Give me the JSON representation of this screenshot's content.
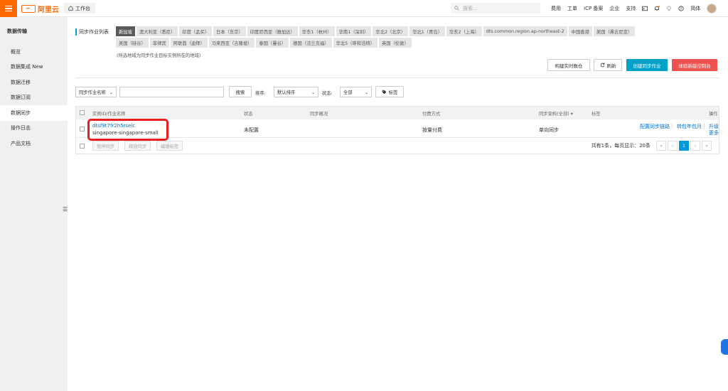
{
  "topbar": {
    "logo_text": "阿里云",
    "workbench_label": "工作台",
    "search_placeholder": "搜索...",
    "nav": [
      "费用",
      "工单",
      "ICP 备案",
      "企业",
      "支持"
    ],
    "lang": "简体",
    "accent": "#ff6a00"
  },
  "sidebar": {
    "title": "数据传输",
    "items": [
      "概览",
      "数据集成 New",
      "数据迁移",
      "数据订阅",
      "数据同步",
      "操作日志",
      "产品文档"
    ],
    "active_index": 4
  },
  "main": {
    "section_title": "同步作业列表",
    "regions": [
      "新加坡",
      "澳大利亚（悉尼）",
      "印度（孟买）",
      "日本（东京）",
      "印度尼西亚（雅加达）",
      "华东1（杭州）",
      "华南1（深圳）",
      "华北2（北京）",
      "华北1（青岛）",
      "华东2（上海）",
      "dts.common.region.ap-northeast-2",
      "中国香港",
      "美国（弗吉尼亚）",
      "美国（硅谷）",
      "菲律宾",
      "阿联酋（迪拜）",
      "马来西亚（吉隆坡）",
      "泰国（曼谷）",
      "德国（法兰克福）",
      "华北5（呼和浩特）",
      "英国（伦敦）"
    ],
    "active_region_index": 0,
    "region_note": "(所选地域为同步作业目标实例所在的地域)",
    "actions": {
      "build_realtime": "构建实时数仓",
      "refresh": "刷新",
      "create": "创建同步作业",
      "new_console": "体验新版控制台"
    },
    "filters": {
      "field_select": "同步作业名称",
      "search_button": "搜索",
      "sort_label": "排序:",
      "sort_value": "默认排序",
      "status_label": "状态:",
      "status_value": "全部",
      "tag_button": "标签"
    },
    "table": {
      "headers": {
        "id_name": "实例ID/作业名称",
        "status": "状态",
        "overview": "同步概况",
        "billing": "付费方式",
        "arch": "同步架构(全部)",
        "tags": "标签",
        "ops": "操作"
      },
      "row": {
        "id": "dtsf9t7fr2h5rseic",
        "name": "singapore-singapore-small",
        "status": "未配置",
        "billing": "按量付费",
        "arch": "单向同步",
        "op_config": "配置同步链路",
        "op_convert": "转包年包月",
        "op_upgrade": "升级",
        "op_more": "更多"
      },
      "footer": {
        "pause": "暂停同步",
        "release": "释放同步",
        "edit_tags": "编辑标签",
        "summary": "共有1条，每页显示：20条",
        "current_page": "1"
      }
    }
  }
}
